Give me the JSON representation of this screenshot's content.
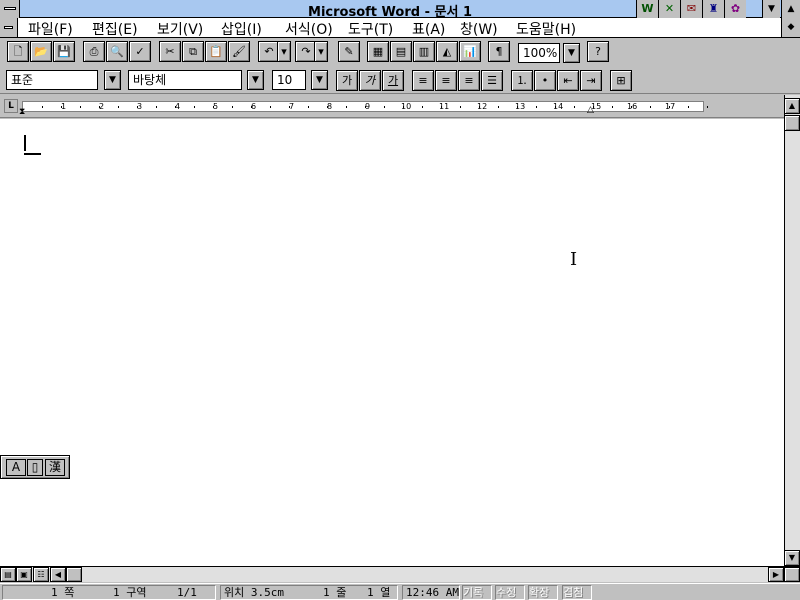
{
  "window": {
    "title": "Microsoft Word - 문서 1",
    "app_icons": [
      "excel-icon",
      "powerpoint-icon",
      "mail-icon",
      "schedule-icon",
      "access-icon"
    ]
  },
  "menu": {
    "items": [
      "파일(F)",
      "편집(E)",
      "보기(V)",
      "삽입(I)",
      "서식(O)",
      "도구(T)",
      "표(A)",
      "창(W)",
      "도움말(H)"
    ]
  },
  "toolbar": {
    "zoom": "100%"
  },
  "format": {
    "style": "표준",
    "font": "바탕체",
    "size": "10",
    "bold": "가",
    "italic": "가",
    "underline": "가"
  },
  "ruler": {
    "numbers": [
      "1",
      "2",
      "3",
      "4",
      "5",
      "6",
      "7",
      "8",
      "9",
      "10",
      "11",
      "12",
      "13",
      "14",
      "15",
      "16",
      "17"
    ]
  },
  "ime": {
    "mode": "A",
    "hanja": "漢"
  },
  "status": {
    "page": "1 쪽",
    "section": "1 구역",
    "page_of": "1/1",
    "position": "위치 3.5cm",
    "line": "1 줄",
    "column": "1 열",
    "time": "12:46 AM",
    "rec": "기록",
    "trk": "수정",
    "ext": "확장",
    "ovr": "겹침"
  }
}
